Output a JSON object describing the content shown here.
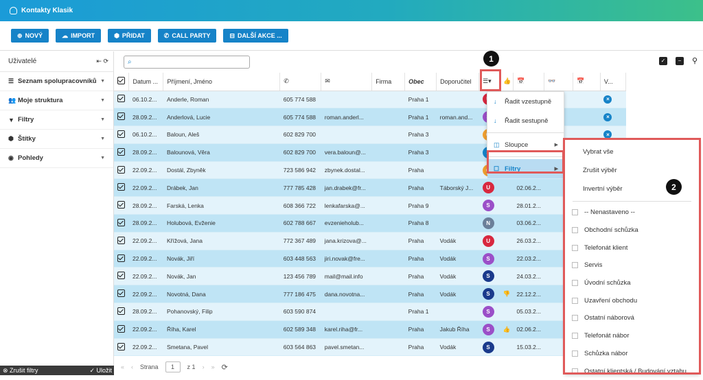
{
  "app": {
    "title": "Kontakty Klasik"
  },
  "toolbar": [
    {
      "icon": "plus-icon",
      "glyph": "⊕",
      "label": "NOVÝ"
    },
    {
      "icon": "upload-icon",
      "glyph": "☁",
      "label": "IMPORT"
    },
    {
      "icon": "tag-icon",
      "glyph": "⬢",
      "label": "PŘIDAT"
    },
    {
      "icon": "phone-icon",
      "glyph": "✆",
      "label": "CALL PARTY"
    },
    {
      "icon": "more-actions-icon",
      "glyph": "⊟",
      "label": "DALŠÍ AKCE ..."
    }
  ],
  "sidebar": {
    "title": "Uživatelé",
    "items": [
      {
        "icon": "list-icon",
        "glyph": "☰",
        "label": "Seznam spolupracovníků"
      },
      {
        "icon": "users-icon",
        "glyph": "👥",
        "label": "Moje struktura"
      },
      {
        "icon": "filter-icon",
        "glyph": "▼",
        "label": "Filtry"
      },
      {
        "icon": "tags-icon",
        "glyph": "⬢",
        "label": "Štítky"
      },
      {
        "icon": "eye-icon",
        "glyph": "◉",
        "label": "Pohledy"
      }
    ],
    "footer_clear": "Zrušit filtry",
    "footer_save": "Uložit"
  },
  "search": {
    "value": ""
  },
  "table": {
    "headers": [
      "Datum ...",
      "Příjmení, Jméno",
      "✆",
      "✉",
      "Firma",
      "Obec",
      "Doporučitel",
      "☰▾",
      "👍",
      "📅",
      "👓",
      "📅",
      "V..."
    ],
    "rows": [
      {
        "date": "06.10.2...",
        "name": "Anderle, Roman",
        "phone": "605 774 588",
        "email": "",
        "firm": "",
        "city": "Praha 1",
        "ref": "",
        "av": "U",
        "avc": "#d8283f",
        "like": "",
        "date2": "",
        "x": true
      },
      {
        "date": "28.09.2...",
        "name": "Anderlová, Lucie",
        "phone": "605 774 588",
        "email": "roman.anderl...",
        "firm": "",
        "city": "Praha 1",
        "ref": "roman.and...",
        "av": "S",
        "avc": "#9b4fc8",
        "like": "",
        "date2": "",
        "x": true
      },
      {
        "date": "06.10.2...",
        "name": "Baloun, Aleš",
        "phone": "602 829 700",
        "email": "",
        "firm": "",
        "city": "Praha 3",
        "ref": "",
        "av": "O",
        "avc": "#f0a030",
        "like": "",
        "date2": "",
        "x": true
      },
      {
        "date": "28.09.2...",
        "name": "Balounová, Věra",
        "phone": "602 829 700",
        "email": "vera.baloun@...",
        "firm": "",
        "city": "Praha 3",
        "ref": "",
        "av": "S",
        "avc": "#1683c8",
        "like": "",
        "date2": "",
        "x": false
      },
      {
        "date": "22.09.2...",
        "name": "Dostál, Zbyněk",
        "phone": "723 586 942",
        "email": "zbynek.dostal...",
        "firm": "",
        "city": "Praha",
        "ref": "",
        "av": "O",
        "avc": "#f0a030",
        "like": "",
        "date2": "",
        "x": false
      },
      {
        "date": "22.09.2...",
        "name": "Drábek, Jan",
        "phone": "777 785 428",
        "email": "jan.drabek@fr...",
        "firm": "",
        "city": "Praha",
        "ref": "Táborský J...",
        "av": "U",
        "avc": "#d8283f",
        "like": "",
        "date2": "02.06.2...",
        "x": false
      },
      {
        "date": "28.09.2...",
        "name": "Farská, Lenka",
        "phone": "608 366 722",
        "email": "lenkafarska@...",
        "firm": "",
        "city": "Praha 9",
        "ref": "",
        "av": "S",
        "avc": "#9b4fc8",
        "like": "",
        "date2": "28.01.2...",
        "x": false
      },
      {
        "date": "28.09.2...",
        "name": "Holubová, Evženie",
        "phone": "602 788 667",
        "email": "evzenieholub...",
        "firm": "",
        "city": "Praha 8",
        "ref": "",
        "av": "N",
        "avc": "#6b7f99",
        "like": "",
        "date2": "03.06.2...",
        "x": false
      },
      {
        "date": "22.09.2...",
        "name": "Křížová, Jana",
        "phone": "772 367 489",
        "email": "jana.krizova@...",
        "firm": "",
        "city": "Praha",
        "ref": "Vodák",
        "av": "U",
        "avc": "#d8283f",
        "like": "",
        "date2": "26.03.2...",
        "x": false
      },
      {
        "date": "22.09.2...",
        "name": "Novák, Jiří",
        "phone": "603 448 563",
        "email": "jiri.novak@fre...",
        "firm": "",
        "city": "Praha",
        "ref": "Vodák",
        "av": "S",
        "avc": "#9b4fc8",
        "like": "",
        "date2": "22.03.2...",
        "x": false
      },
      {
        "date": "22.09.2...",
        "name": "Novák, Jan",
        "phone": "123 456 789",
        "email": "mail@mail.info",
        "firm": "",
        "city": "Praha",
        "ref": "Vodák",
        "av": "S",
        "avc": "#1a3a8c",
        "like": "",
        "date2": "24.03.2...",
        "x": false
      },
      {
        "date": "22.09.2...",
        "name": "Novotná, Dana",
        "phone": "777 186 475",
        "email": "dana.novotna...",
        "firm": "",
        "city": "Praha",
        "ref": "Vodák",
        "av": "S",
        "avc": "#1a3a8c",
        "like": "👎",
        "date2": "22.12.2...",
        "x": false
      },
      {
        "date": "28.09.2...",
        "name": "Pohanovský, Filip",
        "phone": "603 590 874",
        "email": "",
        "firm": "",
        "city": "Praha 1",
        "ref": "",
        "av": "S",
        "avc": "#9b4fc8",
        "like": "",
        "date2": "05.03.2...",
        "x": false
      },
      {
        "date": "22.09.2...",
        "name": "Říha, Karel",
        "phone": "602 589 348",
        "email": "karel.riha@fr...",
        "firm": "",
        "city": "Praha",
        "ref": "Jakub Říha",
        "av": "S",
        "avc": "#9b4fc8",
        "like": "👍",
        "date2": "02.06.2...",
        "x": false
      },
      {
        "date": "22.09.2...",
        "name": "Smetana, Pavel",
        "phone": "603 564 863",
        "email": "pavel.smetan...",
        "firm": "",
        "city": "Praha",
        "ref": "Vodák",
        "av": "S",
        "avc": "#1a3a8c",
        "like": "",
        "date2": "15.03.2...",
        "x": false
      }
    ]
  },
  "pager": {
    "page_label": "Strana",
    "page": "1",
    "of": "z 1"
  },
  "menu1": {
    "items": [
      {
        "icon": "sort-asc-icon",
        "glyph": "↓",
        "label": "Řadit vzestupně"
      },
      {
        "icon": "sort-desc-icon",
        "glyph": "↓",
        "label": "Řadit sestupně"
      },
      {
        "icon": "columns-icon",
        "glyph": "◫",
        "label": "Sloupce",
        "sub": true
      },
      {
        "icon": "filter-checkbox-icon",
        "glyph": "☐",
        "label": "Filtry",
        "sub": true,
        "active": true
      }
    ]
  },
  "menu2": {
    "actions": [
      "Vybrat vše",
      "Zrušit výběr",
      "Invertní výběr"
    ],
    "items": [
      "-- Nenastaveno --",
      "Obchodní schůzka",
      "Telefonát klient",
      "Servis",
      "Úvodní schůzka",
      "Uzavření obchodu",
      "Ostatní náborová",
      "Telefonát nábor",
      "Schůzka nábor",
      "Ostatní klientská / Budování vztahu"
    ]
  },
  "badges": [
    "1",
    "2"
  ]
}
